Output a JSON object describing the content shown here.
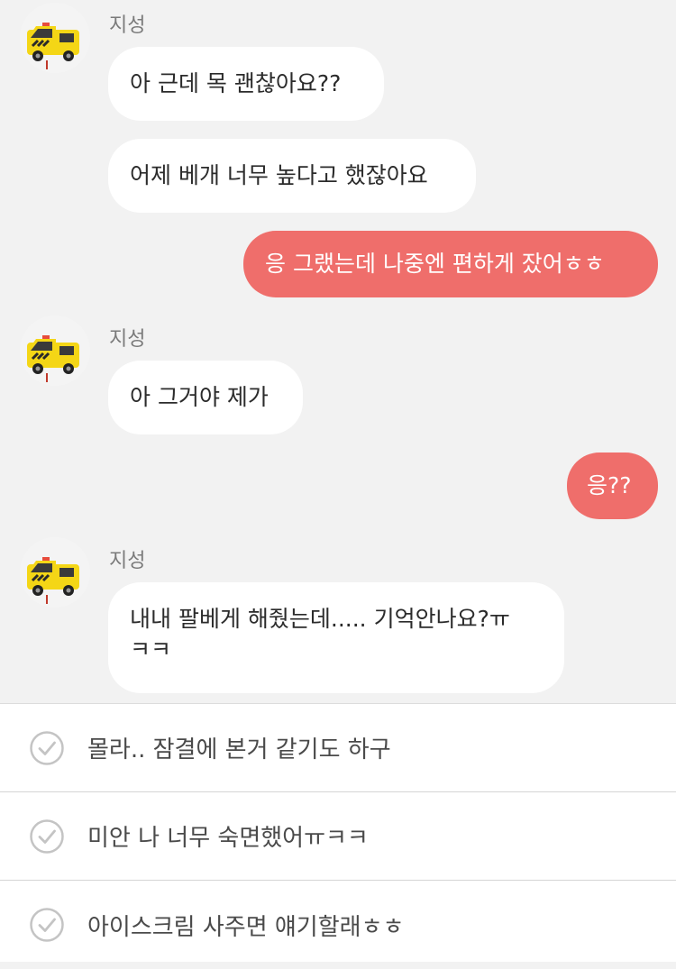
{
  "conversation": {
    "sender_name": "지성",
    "avatar_icon": "ambulance-icon",
    "messages": [
      {
        "from": "them",
        "text": "아 근데 목 괜찮아요??"
      },
      {
        "from": "them",
        "text": "어제 베개 너무 높다고 했잖아요"
      },
      {
        "from": "me",
        "text": "응 그랬는데 나중엔 편하게 잤어ㅎㅎ"
      },
      {
        "from": "them",
        "text": "아 그거야 제가"
      },
      {
        "from": "me",
        "text": "응??"
      },
      {
        "from": "them",
        "line1": "내내 팔베게 해줬는데..... 기억안나요?ㅠ",
        "line2": "ㅋㅋ"
      }
    ]
  },
  "reply_options": [
    {
      "text": "몰라.. 잠결에 본거 같기도 하구",
      "icon": "check-circle-icon"
    },
    {
      "text": "미안 나 너무 숙면했어ㅠㅋㅋ",
      "icon": "check-circle-icon"
    },
    {
      "text": "아이스크림 사주면 얘기할래ㅎㅎ",
      "icon": "check-circle-icon"
    }
  ],
  "colors": {
    "background": "#f2f2f2",
    "incoming_bubble": "#ffffff",
    "outgoing_bubble": "#ef6e6b",
    "options_background": "#ffffff"
  }
}
